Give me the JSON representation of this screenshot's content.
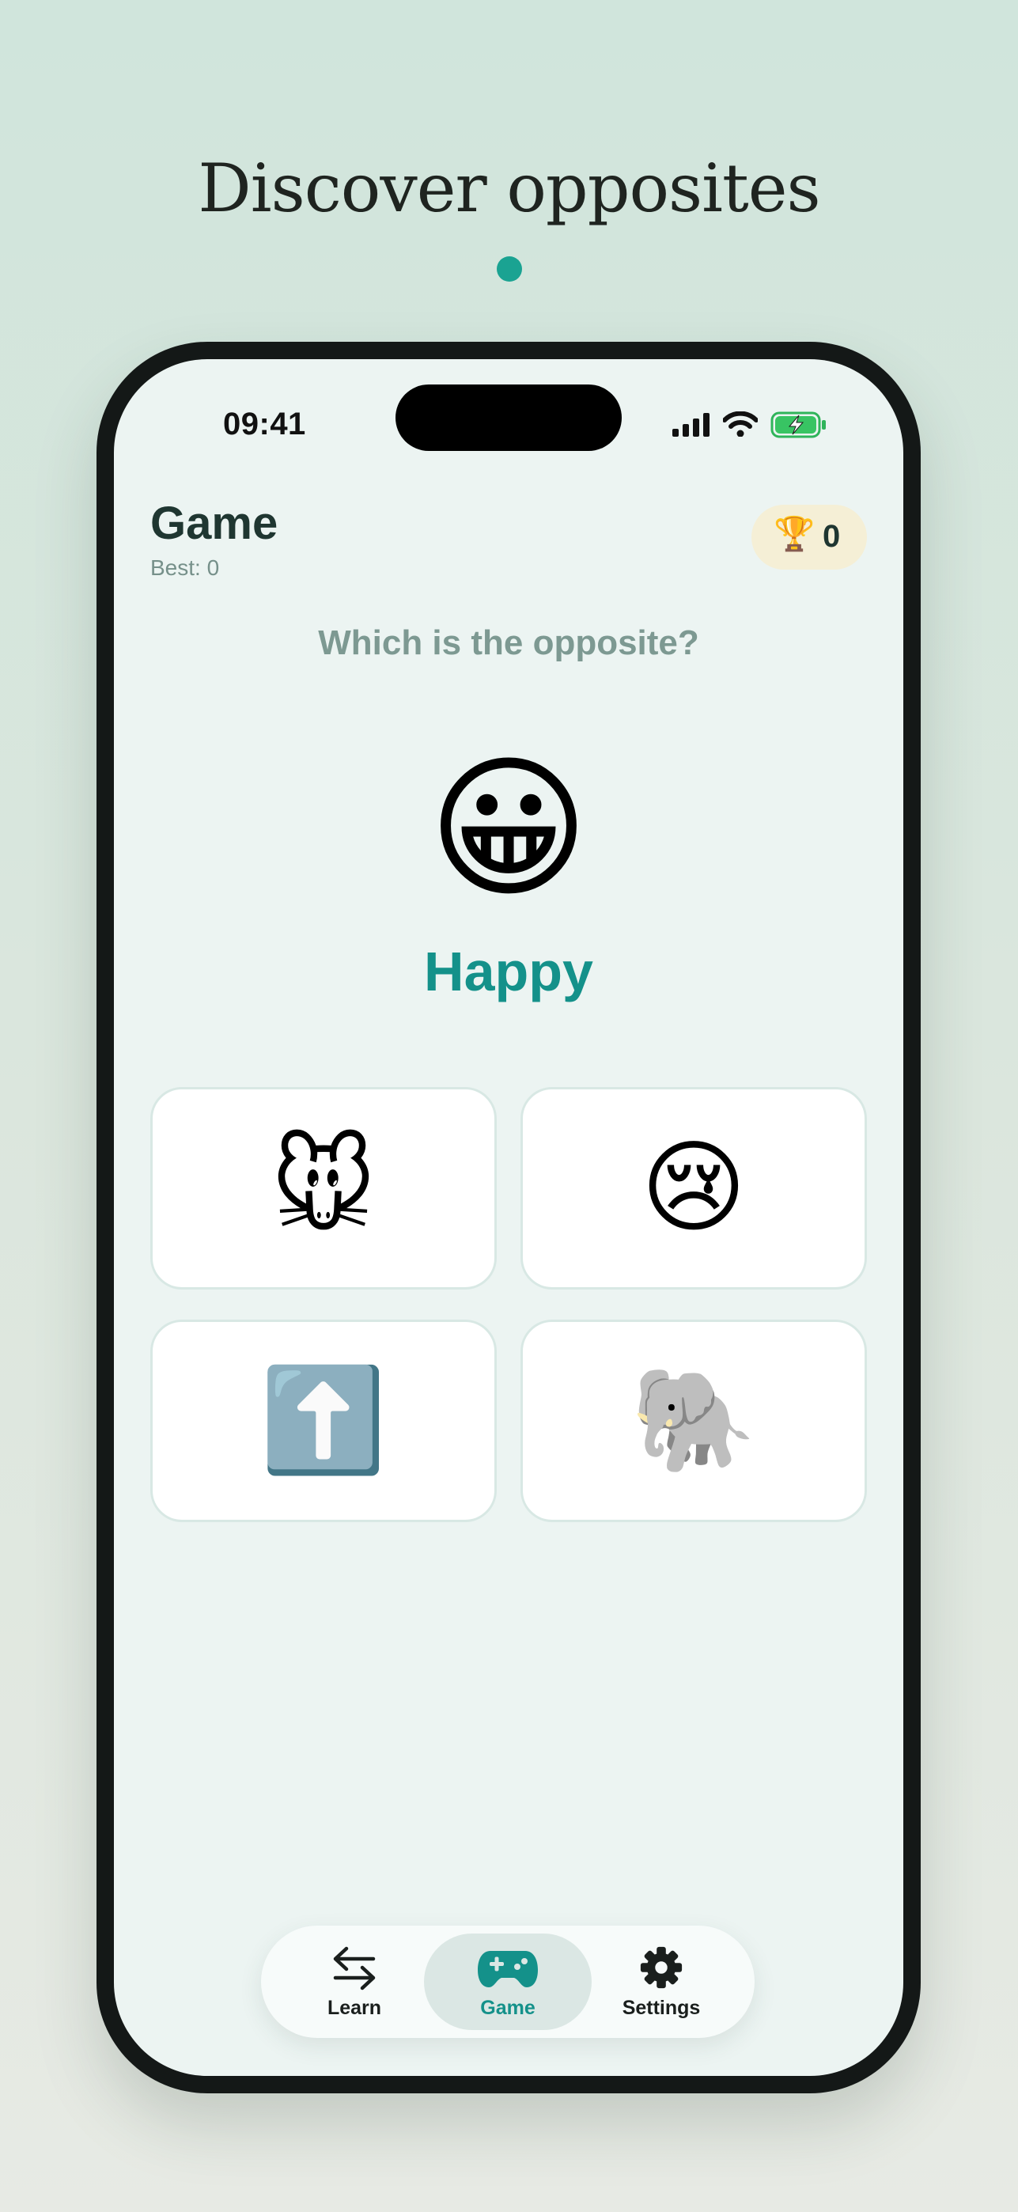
{
  "headline": "Discover opposites",
  "status_bar": {
    "time": "09:41"
  },
  "header": {
    "title": "Game",
    "best": "Best: 0",
    "score": "0",
    "trophy_emoji": "🏆"
  },
  "question": {
    "prompt": "Which is the opposite?",
    "emoji": "😀",
    "word": "Happy"
  },
  "options": [
    {
      "emoji": "🐭",
      "name": "mouse-face"
    },
    {
      "emoji": "😢",
      "name": "crying-face"
    },
    {
      "emoji": "⬆️",
      "name": "up-arrow"
    },
    {
      "emoji": "🐘",
      "name": "elephant"
    }
  ],
  "tabs": [
    {
      "label": "Learn",
      "icon": "arrows-left-right-icon",
      "active": false
    },
    {
      "label": "Game",
      "icon": "game-controller-icon",
      "active": true
    },
    {
      "label": "Settings",
      "icon": "gear-icon",
      "active": false
    }
  ],
  "colors": {
    "accent": "#14918a",
    "dot": "#1aa392",
    "score_pill": "#f5efd6"
  }
}
